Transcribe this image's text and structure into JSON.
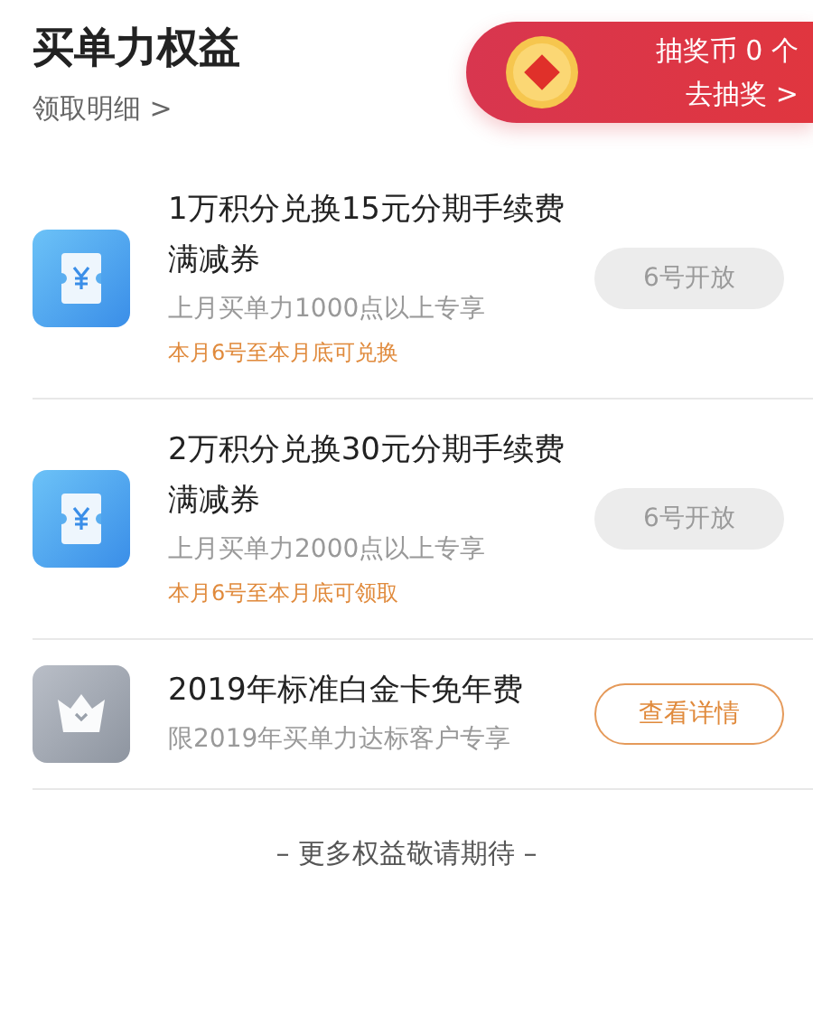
{
  "header": {
    "title": "买单力权益",
    "details_link": "领取明细 >",
    "lottery": {
      "coins": "抽奖币 0 个",
      "action": "去抽奖 >"
    }
  },
  "benefits": [
    {
      "kind": "coupon",
      "title": "1万积分兑换15元分期手续费满减券",
      "subtitle": "上月买单力1000点以上专享",
      "note": "本月6号至本月底可兑换",
      "button": {
        "label": "6号开放",
        "disabled": true
      }
    },
    {
      "kind": "coupon",
      "title": "2万积分兑换30元分期手续费满减券",
      "subtitle": "上月买单力2000点以上专享",
      "note": "本月6号至本月底可领取",
      "button": {
        "label": "6号开放",
        "disabled": true
      }
    },
    {
      "kind": "crown",
      "title": "2019年标准白金卡免年费",
      "subtitle": "限2019年买单力达标客户专享",
      "button": {
        "label": "查看详情",
        "disabled": false
      }
    }
  ],
  "footer": "– 更多权益敬请期待 –"
}
